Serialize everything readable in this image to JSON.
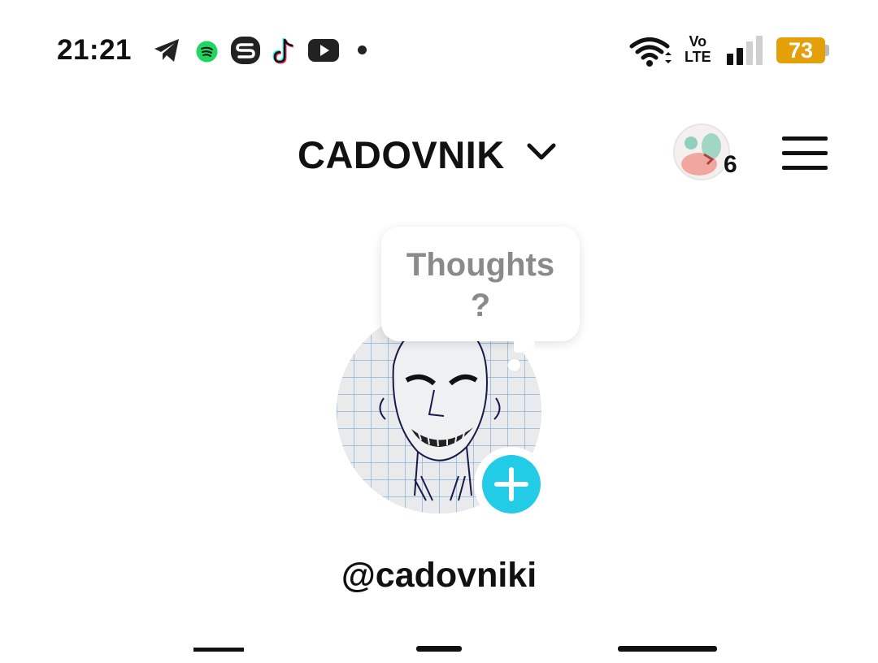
{
  "status_bar": {
    "time": "21:21",
    "volte_top": "Vo",
    "volte_bottom": "LTE",
    "battery": "73",
    "notification_icons": [
      "telegram-icon",
      "spotify-icon",
      "app-s-icon",
      "tiktok-icon",
      "youtube-icon"
    ],
    "battery_color": "#e3a008"
  },
  "header": {
    "account_name": "CADOVNIK",
    "story_count": "6"
  },
  "profile": {
    "thought_bubble": "Thoughts\n?",
    "handle": "@cadovniki",
    "accent_color": "#22cce6"
  }
}
